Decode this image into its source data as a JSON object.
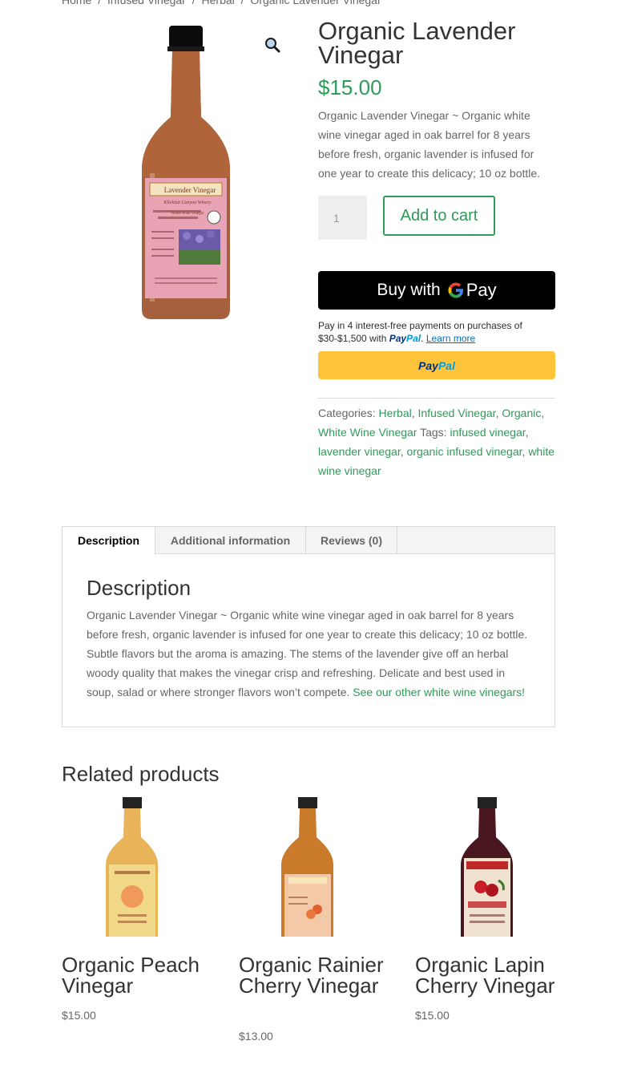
{
  "breadcrumb": {
    "home": "Home",
    "cat1": "Infused Vinegar",
    "cat2": "Herbal",
    "current": "Organic Lavender Vinegar",
    "separator": "/"
  },
  "product": {
    "title": "Organic Lavender Vinegar",
    "price": "$15.00",
    "short_description": "Organic Lavender Vinegar ~ Organic white wine vinegar aged in oak barrel for 8 years before fresh, organic lavender is infused for one year to create this delicacy; 10 oz bottle.",
    "quantity": "1",
    "add_to_cart": "Add to cart",
    "bottle_label": "Lavender Vinegar",
    "bottle_sublabel": "Klickitat Canyon Winery",
    "bottle_subtitle": "White Wine Vinegar"
  },
  "payment": {
    "gpay_buy": "Buy with",
    "gpay_g": "G",
    "gpay_pay": "Pay",
    "paylater_text1": "Pay in 4 interest-free payments on purchases of $30-$1,500 with",
    "paylater_logo_pay": "Pay",
    "paylater_logo_pal": "Pal",
    "paylater_dot": ".",
    "paylater_learn": "Learn more",
    "paypal_pay": "Pay",
    "paypal_pal": "Pal"
  },
  "meta": {
    "categories_label": "Categories:",
    "categories": [
      "Herbal",
      "Infused Vinegar",
      "Organic",
      "White Wine Vinegar"
    ],
    "tags_label": "Tags:",
    "tags": [
      "infused vinegar",
      "lavender vinegar",
      "organic infused vinegar",
      "white wine vinegar"
    ]
  },
  "tabs": {
    "items": [
      "Description",
      "Additional information",
      "Reviews (0)"
    ],
    "active": 0,
    "heading": "Description",
    "text": "Organic Lavender Vinegar ~ Organic white wine vinegar aged in oak barrel for 8 years before fresh, organic lavender is infused for one year to create this delicacy; 10 oz bottle. Subtle flavors but the aroma is amazing. The stems of the lavender give off an herbal woody quality that makes the vinegar crisp and refreshing. Delicate and best used in soup, salad or where stronger flavors won’t compete.",
    "link": "See our other white wine vinegars!"
  },
  "related": {
    "title": "Related products",
    "items": [
      {
        "name": "Organic Peach Vinegar",
        "price": "$15.00",
        "liquid": "#e9b35a",
        "label_color": "#f2d98a"
      },
      {
        "name": "Organic Rainier Cherry Vinegar",
        "price": "$13.00",
        "liquid": "#c97a2a",
        "label_color": "#f4c9a8"
      },
      {
        "name": "Organic Lapin Cherry Vinegar",
        "price": "$15.00",
        "liquid": "#4a1620",
        "label_color": "#f0e2d0"
      }
    ]
  },
  "colors": {
    "accent": "#2e9b58",
    "lavender_liquid": "#a0522d",
    "label_pink": "#e8a3b5"
  },
  "icons": {
    "zoom": "magnifier-icon"
  }
}
